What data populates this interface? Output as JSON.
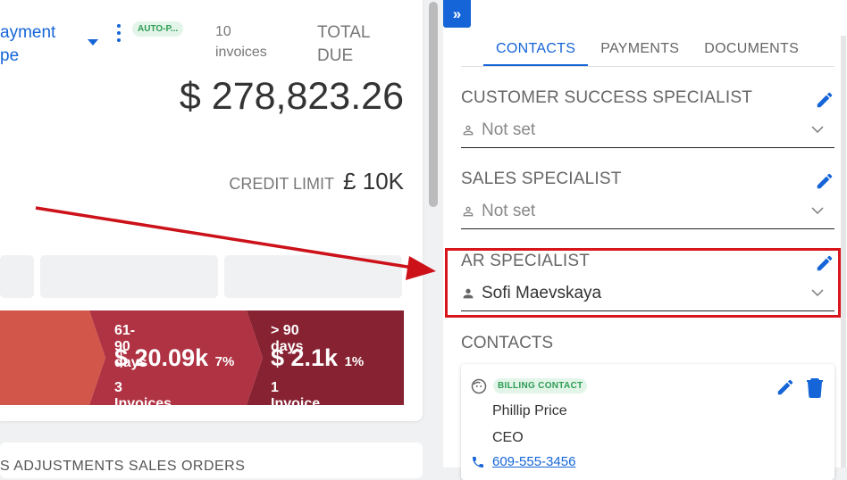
{
  "left": {
    "payment_type_line1": "ayment",
    "payment_type_line2": "pe",
    "auto_badge": "AUTO-P...",
    "invoice_count_line1": "10",
    "invoice_count_line2": "invoices",
    "total_due_line1": "TOTAL",
    "total_due_line2": "DUE",
    "total_amount": "$ 278,823.26",
    "credit_limit_label": "CREDIT LIMIT",
    "credit_limit_value": "£ 10K",
    "aging": [
      {
        "label": "",
        "value": "",
        "percent": "",
        "count": "",
        "color": "#d2574a"
      },
      {
        "label": "61-90 days",
        "value": "$ 20.09k",
        "percent": "7%",
        "count": "3 Invoices",
        "color": "#b03344"
      },
      {
        "label": "> 90 days",
        "value": "$ 2.1k",
        "percent": "1%",
        "count": "1 Invoice",
        "color": "#862231"
      }
    ],
    "bottom_tabs": "S    ADJUSTMENTS    SALES ORDERS"
  },
  "right": {
    "collapse_icon": "»",
    "tabs": [
      {
        "label": "CONTACTS",
        "active": true
      },
      {
        "label": "PAYMENTS",
        "active": false
      },
      {
        "label": "DOCUMENTS",
        "active": false
      }
    ],
    "fields": [
      {
        "title": "CUSTOMER SUCCESS SPECIALIST",
        "value": "Not set"
      },
      {
        "title": "SALES SPECIALIST",
        "value": "Not set"
      },
      {
        "title": "AR SPECIALIST",
        "value": "Sofi Maevskaya"
      }
    ],
    "contacts_title": "CONTACTS",
    "contact": {
      "badge": "BILLING CONTACT",
      "name": "Phillip Price",
      "role": "CEO",
      "phone": "609-555-3456"
    }
  },
  "colors": {
    "accent": "#1565d8",
    "highlight": "#d9151c",
    "arrow": "#cc1119",
    "badge_bg": "#e3f5e9",
    "badge_text": "#2e9d55"
  }
}
